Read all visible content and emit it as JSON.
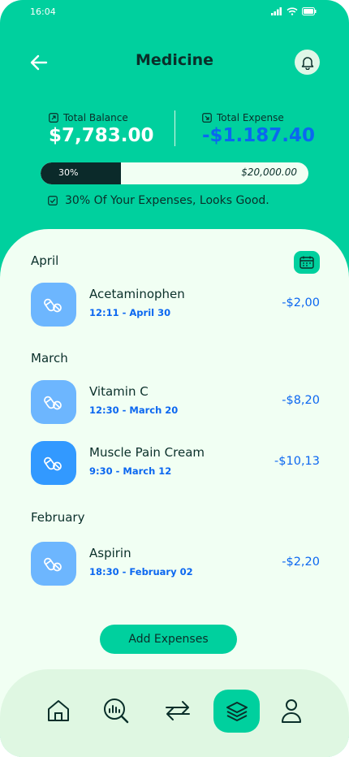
{
  "status": {
    "time": "16:04"
  },
  "header": {
    "title": "Medicine"
  },
  "balance": {
    "total_label": "Total Balance",
    "total_value": "$7,783.00",
    "expense_label": "Total Expense",
    "expense_value": "-$1.187.40"
  },
  "progress": {
    "percent_label": "30%",
    "fraction": 0.3,
    "goal": "$20,000.00"
  },
  "note": "30% Of Your Expenses, Looks Good.",
  "groups": [
    {
      "month": "April",
      "items": [
        {
          "name": "Acetaminophen",
          "when": "12:11 - April 30",
          "amount": "-$2,00"
        }
      ]
    },
    {
      "month": "March",
      "items": [
        {
          "name": "Vitamin C",
          "when": "12:30 - March 20",
          "amount": "-$8,20"
        },
        {
          "name": "Muscle Pain Cream",
          "when": "9:30 - March 12",
          "amount": "-$10,13"
        }
      ]
    },
    {
      "month": "February",
      "items": [
        {
          "name": "Aspirin",
          "when": "18:30 - February 02",
          "amount": "-$2,20"
        }
      ]
    }
  ],
  "actions": {
    "add_label": "Add Expenses"
  },
  "nav": {
    "items": [
      "home-icon",
      "analysis-icon",
      "transfer-icon",
      "layers-icon",
      "profile-icon"
    ],
    "active": "layers-icon"
  },
  "colors": {
    "primary": "#00d09e",
    "dark": "#0a2f2a",
    "blue": "#0b67f0",
    "light": "#f1fff3"
  }
}
